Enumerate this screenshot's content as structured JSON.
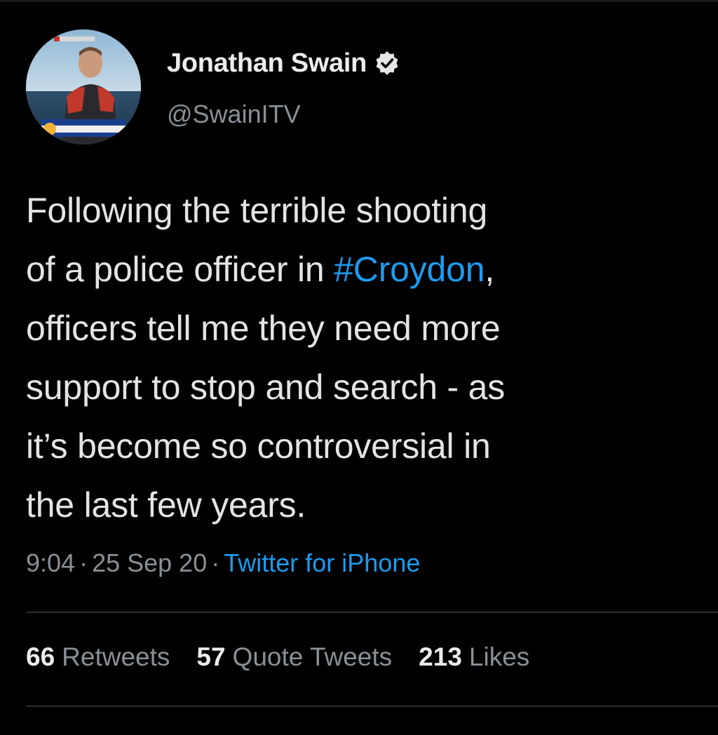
{
  "tweet": {
    "author": {
      "display_name": "Jonathan Swain",
      "handle": "@SwainITV",
      "verified": true,
      "avatar_icon": "profile-photo"
    },
    "text_lines": [
      {
        "text": "Following the terrible shooting"
      },
      {
        "before": "of a police officer in ",
        "hashtag": "#Croydon",
        "after": ","
      },
      {
        "text": "officers tell me they need more"
      },
      {
        "text": "support to stop and search - as"
      },
      {
        "text": "it’s  become so controversial in"
      },
      {
        "text": "the last few years."
      }
    ],
    "meta": {
      "time": "9:04",
      "separator": "·",
      "date": "25 Sep 20",
      "source": "Twitter for iPhone"
    },
    "stats": {
      "retweets": {
        "count": "66",
        "label": "Retweets"
      },
      "quote_tweets": {
        "count": "57",
        "label": "Quote Tweets"
      },
      "likes": {
        "count": "213",
        "label": "Likes"
      }
    }
  },
  "colors": {
    "background": "#000000",
    "link": "#1d9bf0",
    "text_primary": "#e4e4e4",
    "text_secondary": "#8a9096"
  }
}
